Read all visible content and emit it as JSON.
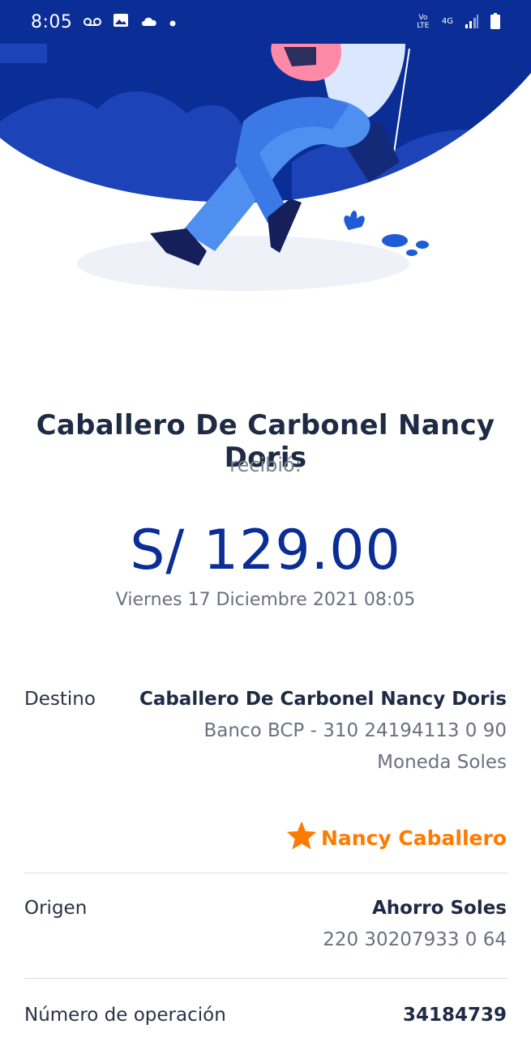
{
  "status_bar": {
    "time": "8:05",
    "net_label": "Vo LTE",
    "net_type": "4G"
  },
  "receipt": {
    "recipient_name": "Caballero De Carbonel Nancy Doris",
    "received_label": "recibió:",
    "amount": "S/ 129.00",
    "date": "Viernes 17 Diciembre 2021 08:05"
  },
  "details": {
    "destino": {
      "label": "Destino",
      "name": "Caballero De Carbonel Nancy Doris",
      "bank_account": "Banco BCP - 310 24194113 0 90",
      "currency": "Moneda Soles",
      "favorite_name": "Nancy Caballero"
    },
    "origen": {
      "label": "Origen",
      "account_name": "Ahorro Soles",
      "account_number": "220 30207933 0 64"
    },
    "operacion": {
      "label": "Número de operación",
      "value": "34184739"
    }
  },
  "colors": {
    "brand_blue": "#0a2d96",
    "accent_orange": "#ff7a00"
  }
}
